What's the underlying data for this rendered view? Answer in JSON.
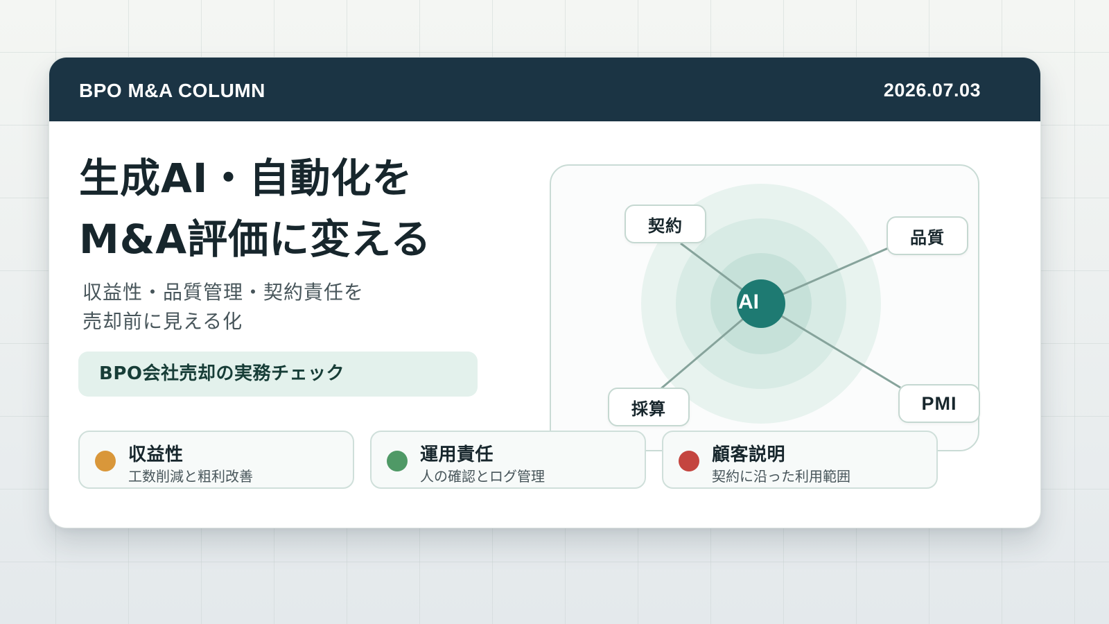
{
  "header": {
    "brand": "BPO M&A COLUMN",
    "date": "2026.07.03"
  },
  "hero": {
    "title_line1": "生成AI・自動化を",
    "title_line2": "M&A評価に変える",
    "subtitle_line1": "収益性・品質管理・契約責任を",
    "subtitle_line2": "売却前に見える化",
    "pill": "BPO会社売却の実務チェック"
  },
  "diagram": {
    "center": "AI",
    "nodes": [
      "契約",
      "品質",
      "採算",
      "PMI"
    ]
  },
  "tiles": [
    {
      "title": "収益性",
      "sub": "工数削減と粗利改善",
      "color": "#d9973a"
    },
    {
      "title": "運用責任",
      "sub": "人の確認とログ管理",
      "color": "#4f9966"
    },
    {
      "title": "顧客説明",
      "sub": "契約に沿った利用範囲",
      "color": "#c4453f"
    }
  ],
  "colors": {
    "header_bg": "#1b3444",
    "accent_teal": "#1e7a72",
    "ring": "#d7ebe5",
    "connector": "#86a39b"
  }
}
